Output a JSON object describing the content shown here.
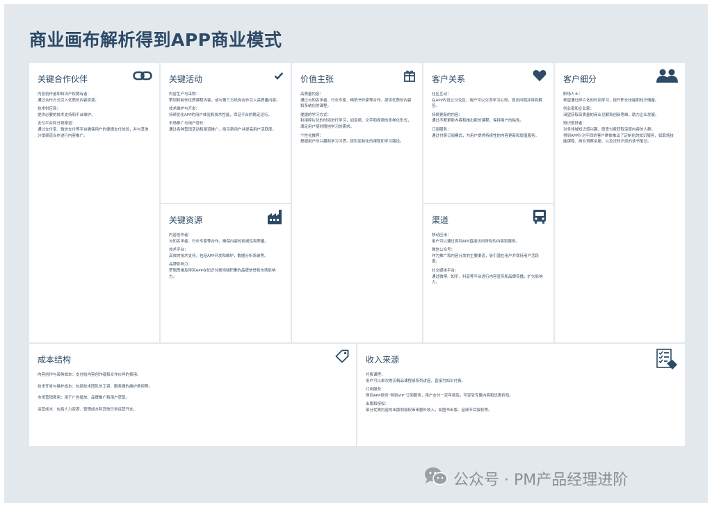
{
  "title": "商业画布解析得到APP商业模式",
  "boxes": {
    "partners": {
      "title": "关键合作伙伴",
      "icon": "link-icon",
      "lines": [
        "内容创作者和知识产权拥有者：",
        "通过合作方式引入优质的内容资源。",
        "技术供应商：",
        "提供必要的技术支持和平台维护。",
        "支付平台和分销渠道：",
        "通过支付宝、微信支付等平台确保用户的便捷支付体验，并与其他分销渠道合作进行内容推广。"
      ]
    },
    "activities": {
      "title": "关键活动",
      "icon": "check-icon",
      "lines": [
        "内容生产与采购：",
        "策划和制作优质课程内容，或与第三方机构合作引入高质量内容。",
        "技术维护与开发：",
        "持续优化APP的用户体验和技术性能，保证平台的稳定运行。",
        "市场推广与用户增长：",
        "通过各种营销活动和渠道推广，吸引新用户并提高用户活跃度。"
      ]
    },
    "resources": {
      "title": "关键资源",
      "icon": "factory-icon",
      "lines": [
        "内容创作者：",
        "与知名学者、行业专家等合作，确保内容的权威性和质量。",
        "技术平台：",
        "高效的技术支持，包括APP开发和维护，数据分析系统等。",
        "品牌影响力：",
        "罗辑思维及得到APP在知识付费领域积累的品牌信誉和市场影响力。"
      ]
    },
    "value": {
      "title": "价值主张",
      "icon": "gift-icon",
      "lines": [
        "高质量内容：",
        "通过与知名学者、行业专家、畅销书作家等合作，提供优质的内容和系统化的课程。",
        "便捷的学习方式：",
        "利用碎片化的时间进行学习，如音频、文字和视频的多样化形式，满足用户随时随地学习的需求。",
        "个性化推荐：",
        "根据用户的兴趣和学习习惯，提供定制化的课程和学习路径。"
      ]
    },
    "relationships": {
      "title": "客户关系",
      "icon": "heart-icon",
      "lines": [
        "社区互动：",
        "在APP内设立讨论区，用户可以交流学习心得，提出问题并得到解答。",
        "持续更新的内容：",
        "通过不断更新内容和推出新的课程，保持用户的粘性。",
        "订阅服务：",
        "通过付费订阅模式，为用户提供持续性的内容更新和增值服务。"
      ]
    },
    "channels": {
      "title": "渠道",
      "icon": "truck-icon",
      "lines": [
        "移动应用：",
        "用户可以通过得到APP直接访问所有的内容和服务。",
        "微信公众号：",
        "作为推广和内容分发的主要渠道，吸引潜在用户并保持用户活跃度。",
        "社交媒体平台：",
        "通过微博、知乎、抖音等平台进行内容宣传和品牌传播，扩大影响力。"
      ]
    },
    "segments": {
      "title": "客户细分",
      "icon": "users-icon",
      "lines": [
        "职场人士：",
        "希望通过碎片化的时间学习，提升职业技能和知识储备。",
        "创业者和企业家：",
        "渴望获取高质量的商业见解和创新思维，助力企业发展。",
        "知识爱好者：",
        "对多领域知识感兴趣，愿意付费获取深度内容的人群。",
        "得到APP针对不同的客户群体推出了定制化的知识服务，如职场技能课程、商业洞察讲座、以及泛知识类的读书笔记。"
      ]
    },
    "cost": {
      "title": "成本结构",
      "icon": "tag-icon",
      "lines": [
        "内容创作与采购成本：支付给内容创作者和合作伙伴的费用。",
        "技术开发与维护成本：包括技术团队的工资、服务器的维护费用等。",
        "市场营销费用：用于广告投放、品牌推广和用户获取。",
        "运营成本：包括人力资源、管理成本和其他日常运营开支。"
      ]
    },
    "revenue": {
      "title": "收入来源",
      "icon": "checklist-icon",
      "lines": [
        "付费课程：",
        "用户可以单次购买精品课程或系列讲座，直接为知识付费。",
        "订阅服务：",
        "得到APP提供“得到VIP”订阅服务，用户支付一定年费后，可享受专属内容和优惠折扣。",
        "出版和授权：",
        "部分优质内容的出版和授权带来额外收入，如图书出版、音频节目授权等。"
      ]
    }
  },
  "watermark": {
    "icon": "wechat-icon",
    "text": "公众号 · PM产品经理进阶"
  },
  "colors": {
    "background": "#e3e8ed",
    "card": "#ffffff",
    "accent": "#2d4a66"
  }
}
